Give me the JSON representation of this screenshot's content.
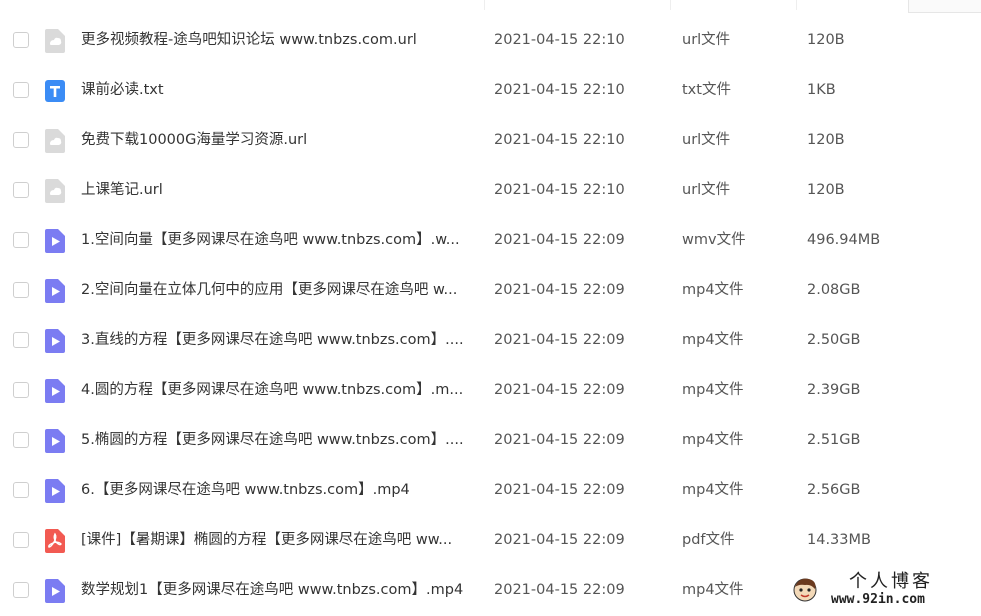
{
  "files": [
    {
      "name": "更多视频教程-途鸟吧知识论坛 www.tnbzs.com.url",
      "modified": "2021-04-15 22:10",
      "type": "url文件",
      "size": "120B",
      "icon": "link-file-icon"
    },
    {
      "name": "课前必读.txt",
      "modified": "2021-04-15 22:10",
      "type": "txt文件",
      "size": "1KB",
      "icon": "text-file-icon"
    },
    {
      "name": "免费下载10000G海量学习资源.url",
      "modified": "2021-04-15 22:10",
      "type": "url文件",
      "size": "120B",
      "icon": "link-file-icon"
    },
    {
      "name": "上课笔记.url",
      "modified": "2021-04-15 22:10",
      "type": "url文件",
      "size": "120B",
      "icon": "link-file-icon"
    },
    {
      "name": "1.空间向量【更多网课尽在途鸟吧 www.tnbzs.com】.w...",
      "modified": "2021-04-15 22:09",
      "type": "wmv文件",
      "size": "496.94MB",
      "icon": "video-file-icon"
    },
    {
      "name": "2.空间向量在立体几何中的应用【更多网课尽在途鸟吧 w...",
      "modified": "2021-04-15 22:09",
      "type": "mp4文件",
      "size": "2.08GB",
      "icon": "video-file-icon"
    },
    {
      "name": "3.直线的方程【更多网课尽在途鸟吧 www.tnbzs.com】....",
      "modified": "2021-04-15 22:09",
      "type": "mp4文件",
      "size": "2.50GB",
      "icon": "video-file-icon"
    },
    {
      "name": "4.圆的方程【更多网课尽在途鸟吧 www.tnbzs.com】.m...",
      "modified": "2021-04-15 22:09",
      "type": "mp4文件",
      "size": "2.39GB",
      "icon": "video-file-icon"
    },
    {
      "name": "5.椭圆的方程【更多网课尽在途鸟吧 www.tnbzs.com】....",
      "modified": "2021-04-15 22:09",
      "type": "mp4文件",
      "size": "2.51GB",
      "icon": "video-file-icon"
    },
    {
      "name": "6.【更多网课尽在途鸟吧 www.tnbzs.com】.mp4",
      "modified": "2021-04-15 22:09",
      "type": "mp4文件",
      "size": "2.56GB",
      "icon": "video-file-icon"
    },
    {
      "name": "[课件]【暑期课】椭圆的方程【更多网课尽在途鸟吧 ww...",
      "modified": "2021-04-15 22:09",
      "type": "pdf文件",
      "size": "14.33MB",
      "icon": "pdf-file-icon"
    },
    {
      "name": "数学规划1【更多网课尽在途鸟吧 www.tnbzs.com】.mp4",
      "modified": "2021-04-15 22:09",
      "type": "mp4文件",
      "size": "",
      "icon": "video-file-icon"
    }
  ],
  "watermark": {
    "title": "个人博客",
    "url": "www.92in.com"
  },
  "colors": {
    "link_icon": "#dadada",
    "text_icon": "#3b8cf5",
    "video_icon": "#7b7cf2",
    "pdf_icon": "#f25a52",
    "checkbox_border": "#cfcfcf"
  }
}
